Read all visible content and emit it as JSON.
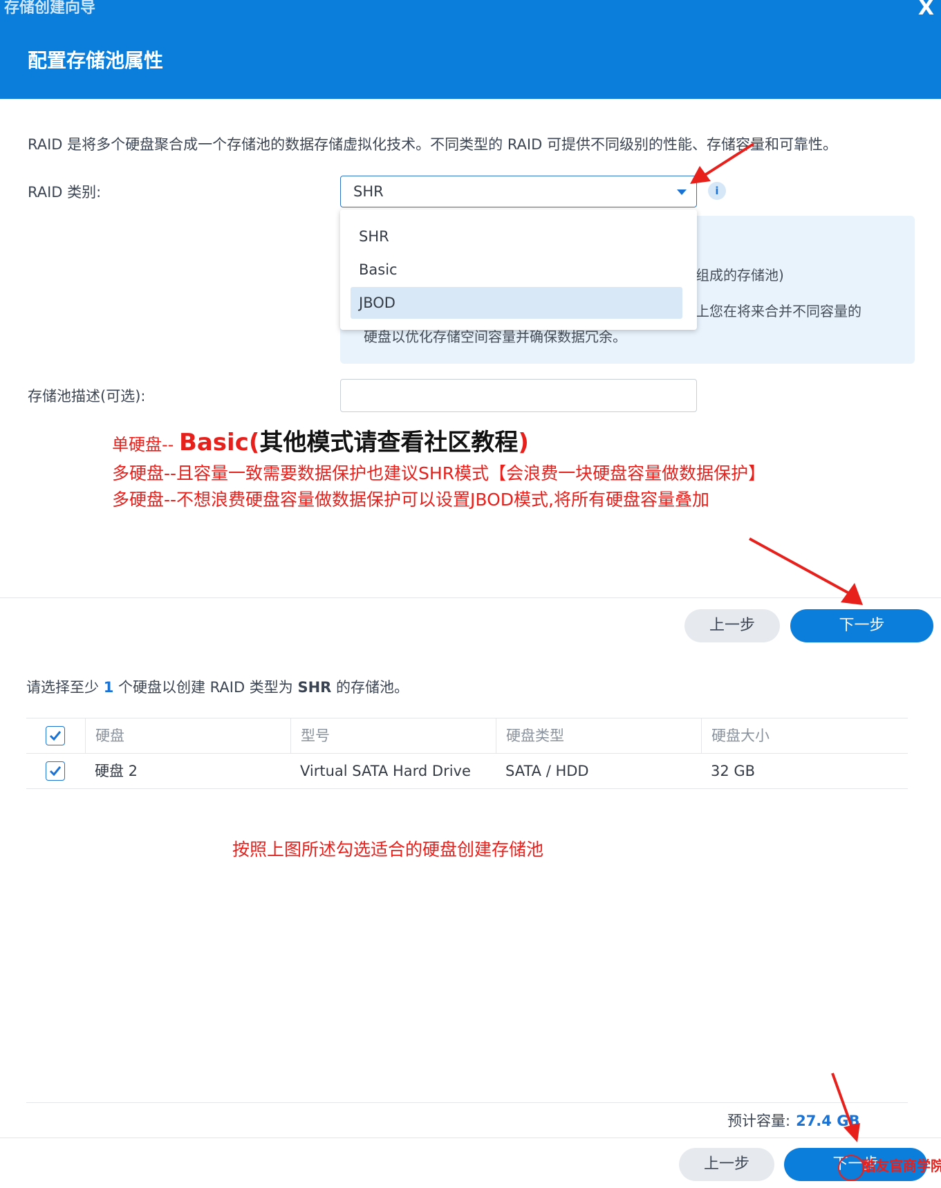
{
  "window": {
    "title": "存储创建向导",
    "close_label": "X"
  },
  "header": {
    "page_title": "配置存储池属性"
  },
  "intro": "RAID 是将多个硬盘聚合成一个存储池的数据存储虚拟化技术。不同类型的 RAID 可提供不同级别的性能、存储容量和可靠性。",
  "raid": {
    "label": "RAID 类别:",
    "selected": "SHR",
    "options": [
      "SHR",
      "Basic",
      "JBOD"
    ],
    "highlighted_option": "JBOD"
  },
  "info_panel": {
    "line1": "组成的存储池)",
    "line2": "上您在将来合并不同容量的",
    "line3": "硬盘以优化存储空间容量并确保数据冗余。"
  },
  "description": {
    "label": "存储池描述(可选):",
    "value": ""
  },
  "annotations": {
    "line1_prefix": "单硬盘-- ",
    "line1_red": "Basic(",
    "line1_black": "其他模式请查看社区教程",
    "line1_close": ")",
    "line2": "多硬盘--且容量一致需要数据保护也建议SHR模式【会浪费一块硬盘容量做数据保护】",
    "line3": "多硬盘--不想浪费硬盘容量做数据保护可以设置JBOD模式,将所有硬盘容量叠加",
    "line4": "按照上图所述勾选适合的硬盘创建存储池"
  },
  "buttons": {
    "prev": "上一步",
    "next": "下一步"
  },
  "disk_section": {
    "instruction_pre": "请选择至少 ",
    "instruction_num": "1",
    "instruction_mid": " 个硬盘以创建 RAID 类型为 ",
    "instruction_type": "SHR",
    "instruction_post": " 的存储池。",
    "columns": [
      "硬盘",
      "型号",
      "硬盘类型",
      "硬盘大小"
    ],
    "rows": [
      {
        "disk": "硬盘 2",
        "model": "Virtual SATA Hard Drive",
        "type": "SATA / HDD",
        "size": "32 GB",
        "checked": true
      }
    ],
    "capacity_label": "预计容量:",
    "capacity_value": "27.4 GB"
  },
  "watermark": "酷友官商学院",
  "colors": {
    "header": "#0b7ddb",
    "accent": "#1a73d4",
    "annotation_red": "#e8201c"
  }
}
